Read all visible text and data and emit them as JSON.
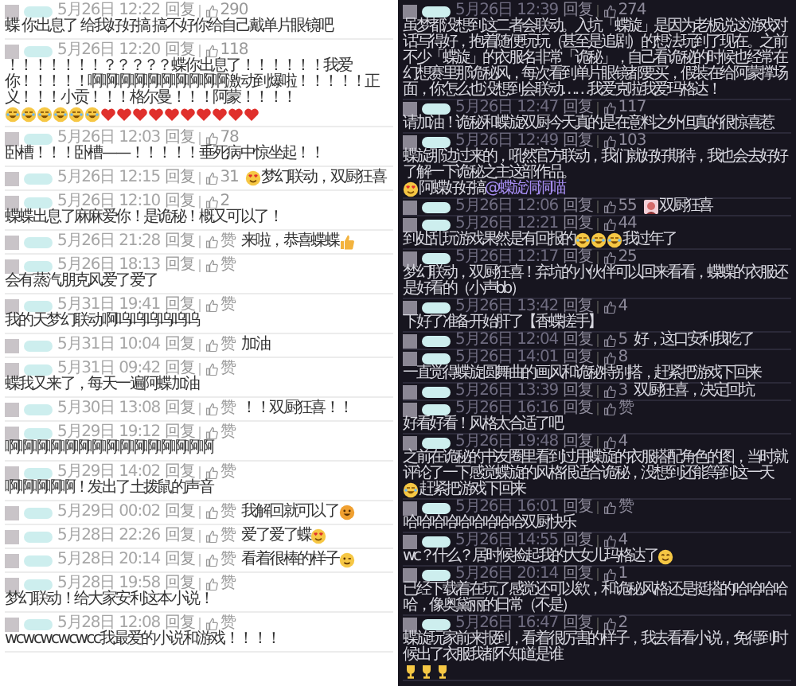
{
  "columns": [
    {
      "comments": [
        {
          "parts": [
            "蝶 你出息了 给我好好搞 搞不好你给自己戴单片眼镜吧"
          ],
          "date": "5月26日 12:22",
          "reply": "回复",
          "likes": "290"
        },
        {
          "parts": [
            "！！！！！！！？？？？？蝶你出息了！！！！！！我爱你！！！！！啊啊啊啊啊啊啊啊啊啊激动到爆啦！！！！！正义！！！小贡！！！格尔曼！！！阿蒙！！！！",
            {
              "kind": "laugh"
            },
            {
              "kind": "laugh"
            },
            {
              "kind": "laugh"
            },
            {
              "kind": "laugh"
            },
            {
              "kind": "laugh"
            },
            {
              "kind": "laugh"
            },
            {
              "kind": "heart"
            },
            {
              "kind": "heart"
            },
            {
              "kind": "heart"
            },
            {
              "kind": "heart"
            },
            {
              "kind": "heart"
            },
            {
              "kind": "heart"
            },
            {
              "kind": "heart"
            },
            {
              "kind": "heart"
            },
            {
              "kind": "heart"
            },
            {
              "kind": "heart"
            }
          ],
          "date": "5月26日 12:20",
          "reply": "回复",
          "likes": "118"
        },
        {
          "parts": [
            "卧槽！！！卧槽——！！！！！垂死病中惊坐起！！"
          ],
          "date": "5月26日 12:03",
          "reply": "回复",
          "likes": "78"
        },
        {
          "parts": [
            {
              "kind": "hearteyes"
            },
            "梦幻联动，双厨狂喜"
          ],
          "date": "5月26日 12:15",
          "reply": "回复",
          "likes": "31"
        },
        {
          "parts": [
            "蝶蝶出息了麻麻爱你！是诡秘！概又可以了！"
          ],
          "date": "5月26日 12:10",
          "reply": "回复",
          "likes": "2"
        },
        {
          "parts": [
            "来啦，恭喜蝶蝶",
            {
              "kind": "thumb"
            }
          ],
          "date": "5月26日 21:28",
          "reply": "回复",
          "likes": "赞"
        },
        {
          "parts": [
            "会有蒸汽朋克风爱了爱了"
          ],
          "date": "5月26日 18:13",
          "reply": "回复",
          "likes": "赞"
        },
        {
          "parts": [
            "我的天梦幻联动啊呜呜呜呜呜呜"
          ],
          "date": "5月31日 19:41",
          "reply": "回复",
          "likes": "赞"
        },
        {
          "parts": [
            "加油"
          ],
          "date": "5月31日 10:04",
          "reply": "回复",
          "likes": "赞"
        },
        {
          "parts": [
            "蝶我又来了，每天一遍阿蝶加油"
          ],
          "date": "5月31日 09:42",
          "reply": "回复",
          "likes": "赞"
        },
        {
          "parts": [
            "！！双厨狂喜！！"
          ],
          "date": "5月30日 13:08",
          "reply": "回复",
          "likes": "赞"
        },
        {
          "parts": [
            "啊啊啊啊啊啊啊啊啊啊啊啊啊啊啊"
          ],
          "date": "5月29日 19:12",
          "reply": "回复",
          "likes": "赞"
        },
        {
          "parts": [
            "啊啊啊啊啊！发出了土拨鼠的声音"
          ],
          "date": "5月29日 14:02",
          "reply": "回复",
          "likes": "赞"
        },
        {
          "parts": [
            "我解回就可以了",
            {
              "kind": "grin"
            }
          ],
          "date": "5月29日 00:02",
          "reply": "回复",
          "likes": "赞"
        },
        {
          "parts": [
            "爱了爱了蝶",
            {
              "kind": "hearteyes"
            }
          ],
          "date": "5月28日 22:26",
          "reply": "回复",
          "likes": "赞"
        },
        {
          "parts": [
            "看着很棒的样子",
            {
              "kind": "wink"
            }
          ],
          "date": "5月28日 20:14",
          "reply": "回复",
          "likes": "赞"
        },
        {
          "parts": [
            "梦幻联动！给大家安利这本小说！"
          ],
          "date": "5月28日 19:58",
          "reply": "回复",
          "likes": "赞"
        },
        {
          "parts": [
            "wcwcwcwcwcc我最爱的小说和游戏！！！！"
          ],
          "date": "5月28日 12:08",
          "reply": "回复",
          "likes": "赞"
        }
      ]
    },
    {
      "comments": [
        {
          "parts": [
            "虽梦都没想到这二者会联动。入坑「蝶旋」是因为老板说这游戏对话写得好，抱着随便玩玩（甚至是追剧）的想法玩到了现在。之前不少「蝶旋」的衣服名非常「诡秘」，自己看诡秘的时候也经常在幻想赛里那诡秘风，每次看到单片眼镜都要买，假装在给阿蒙撑场面，你怎么也没想到会联动……我爱克啦我爱玛格达！"
          ],
          "date": "5月26日 12:39",
          "reply": "回复",
          "likes": "274"
        },
        {
          "parts": [
            "请加油！诡秘和蝶旋双厨今天真的是在意料之外但真的很惊喜惹"
          ],
          "date": "5月26日 12:47",
          "reply": "回复",
          "likes": "117"
        },
        {
          "parts": [
            "蝶旋那边过来的，吼然官方联动，我们就好好期待，我也会去好好了解一下诡秘之主这部作品。",
            {
              "kind": "hearteyes"
            },
            "阿蝶好好搞",
            {
              "kind": "mention",
              "text": "@蝶旋洞洞喵"
            }
          ],
          "date": "5月26日 12:49",
          "reply": "回复",
          "likes": "103"
        },
        {
          "parts": [
            {
              "kind": "sticker"
            },
            "双厨狂喜"
          ],
          "date": "5月26日 12:06",
          "reply": "回复",
          "likes": "55"
        },
        {
          "parts": [
            "到处乱玩游戏果然是有回报的",
            {
              "kind": "laugh"
            },
            {
              "kind": "laugh"
            },
            {
              "kind": "laugh"
            },
            "我过年了"
          ],
          "date": "5月26日 12:21",
          "reply": "回复",
          "likes": "44"
        },
        {
          "parts": [
            "梦幻联动，双厨狂喜！弃坑的小伙伴可以回来看看，蝶蝶的衣服还是好看的（小声bb）"
          ],
          "date": "5月26日 12:17",
          "reply": "回复",
          "likes": "25"
        },
        {
          "parts": [
            "下好了准备开始肝了【香蝶搓手】"
          ],
          "date": "5月26日 13:42",
          "reply": "回复",
          "likes": "4"
        },
        {
          "parts": [
            "好，这口安利我吃了"
          ],
          "date": "5月26日 12:04",
          "reply": "回复",
          "likes": "5"
        },
        {
          "parts": [
            "一直觉得蝶旋圆舞曲的画风和诡秘特别搭，赶紧把游戏下回来"
          ],
          "date": "5月26日 14:01",
          "reply": "回复",
          "likes": "8"
        },
        {
          "parts": [
            "双厨狂喜，决定回坑"
          ],
          "date": "5月26日 13:39",
          "reply": "回复",
          "likes": "3"
        },
        {
          "parts": [
            "好看好看！风格太合适了吧"
          ],
          "date": "5月26日 16:16",
          "reply": "回复",
          "likes": "赞"
        },
        {
          "parts": [
            "之前在诡秘的书友圈里看到过用蝶旋的衣服搭配角色的图，当时就评论了一下感觉蝶旋的风格很适合诡秘，没想到还能等到这一天",
            {
              "kind": "laugh"
            },
            "赶紧把游戏下回来"
          ],
          "date": "5月26日 19:48",
          "reply": "回复",
          "likes": "4"
        },
        {
          "parts": [
            "哈哈哈哈哈哈哈哈哈双厨快乐"
          ],
          "date": "5月26日 16:01",
          "reply": "回复",
          "likes": "赞"
        },
        {
          "parts": [
            "wc？什么？居时候捡起我的大女儿玛格达了",
            {
              "kind": "smile"
            }
          ],
          "date": "5月26日 14:55",
          "reply": "回复",
          "likes": "4"
        },
        {
          "parts": [
            "已经下载着在玩了感觉还可以欸，和诡秘风格还是挺搭的哈哈哈哈哈，像奥黛丽的日常（不是）"
          ],
          "date": "5月26日 20:14",
          "reply": "回复",
          "likes": "1"
        },
        {
          "parts": [
            "蝶旋玩家前来报到，看着很厉害的样子，我去看看小说，免得到时候出了衣服我都不知道是谁",
            {
              "kind": "trophy"
            },
            {
              "kind": "trophy"
            },
            {
              "kind": "trophy"
            }
          ],
          "date": "5月26日 16:47",
          "reply": "回复",
          "likes": "2"
        }
      ]
    }
  ]
}
